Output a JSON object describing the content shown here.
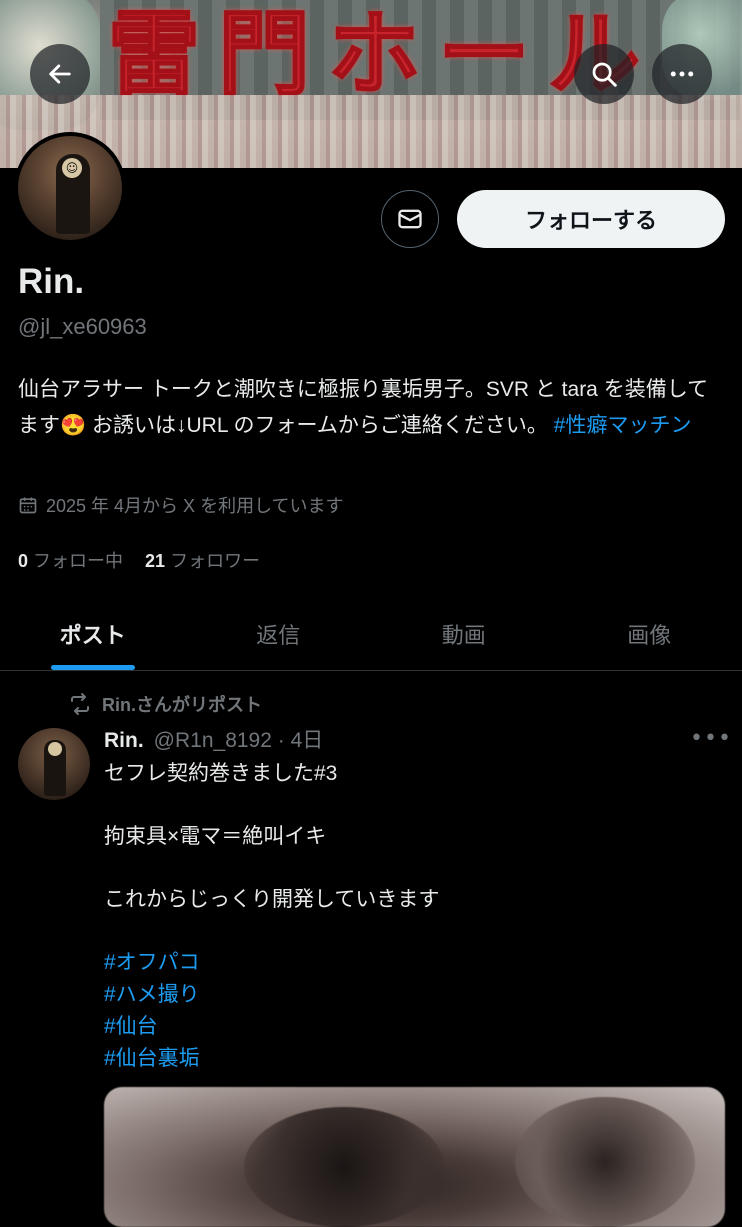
{
  "banner": {
    "sign_text": "雷門ホール"
  },
  "header": {
    "back_icon": "arrow-left-icon",
    "search_icon": "search-icon",
    "more_icon": "more-horizontal-icon"
  },
  "profile": {
    "name": "Rin.",
    "handle": "@jl_xe60963",
    "bio_part1": "仙台アラサー トークと潮吹きに極振り裏垢男子。SVR と tara を装備してます",
    "bio_emoji": "😍",
    "bio_part2": " お誘いは↓URL のフォームからご連絡ください。 ",
    "bio_hashtag": "#性癖マッチン",
    "joined": "2025 年 4月から X を利用しています",
    "following_count": "0",
    "following_label": "フォロー中",
    "followers_count": "21",
    "followers_label": "フォロワー",
    "follow_button": "フォローする",
    "message_icon": "envelope-icon",
    "calendar_icon": "calendar-icon"
  },
  "tabs": [
    {
      "label": "ポスト",
      "active": true
    },
    {
      "label": "返信",
      "active": false
    },
    {
      "label": "動画",
      "active": false
    },
    {
      "label": "画像",
      "active": false
    }
  ],
  "post": {
    "repost_label": "Rin.さんがリポスト",
    "author_name": "Rin.",
    "author_handle_time": "@R1n_8192 · 4日",
    "line1": "セフレ契約巻きました#3",
    "line2": "拘束具×電マ＝絶叫イキ",
    "line3": "これからじっくり開発していきます",
    "hashtags": [
      "#オフパコ",
      "#ハメ撮り",
      "#仙台",
      "#仙台裏垢"
    ],
    "more_label": "•••"
  },
  "colors": {
    "accent": "#1d9bf0",
    "background": "#000000",
    "text": "#e7e9ea",
    "muted": "#71767b",
    "follow_bg": "#eff3f4"
  }
}
